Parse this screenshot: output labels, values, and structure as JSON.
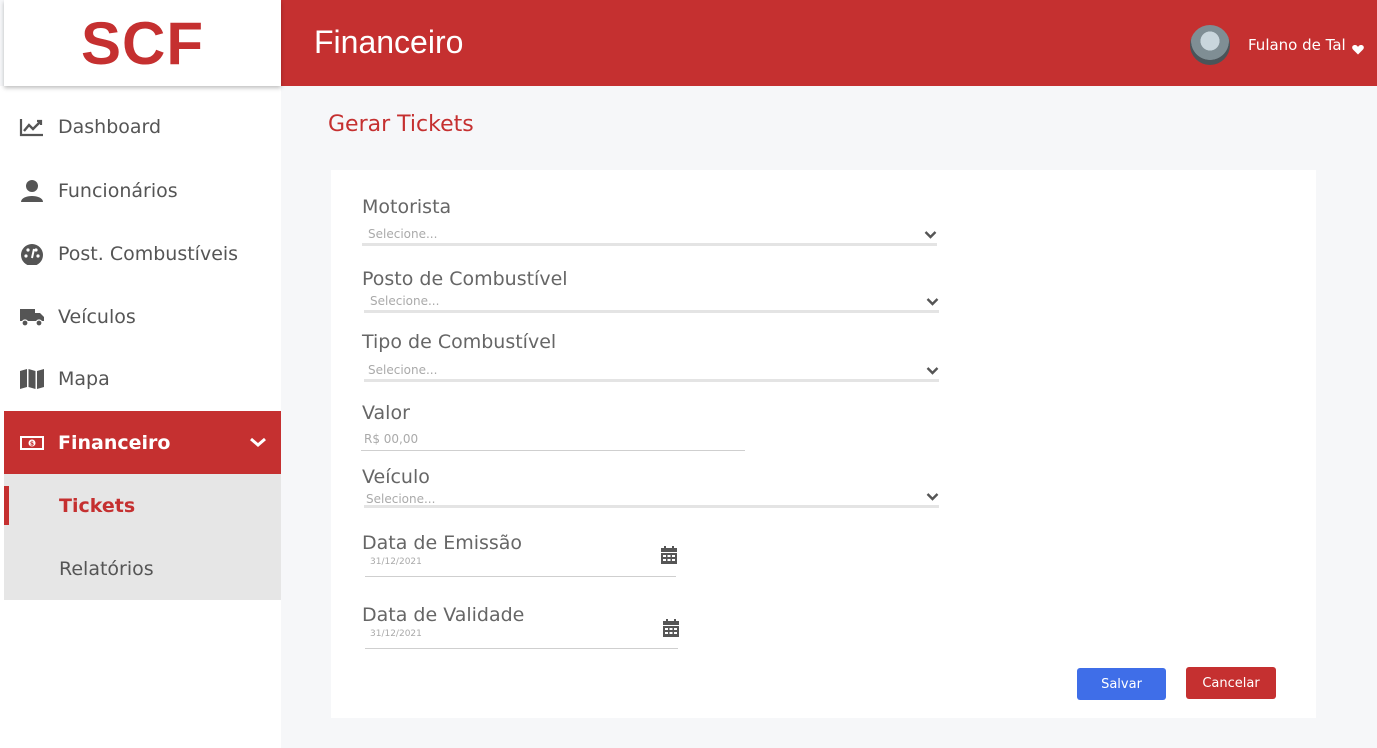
{
  "app": {
    "logo": "SCF"
  },
  "header": {
    "title": "Financeiro",
    "user_name": "Fulano de Tal"
  },
  "sidebar": {
    "items": [
      {
        "label": "Dashboard",
        "icon": "chart-line-icon"
      },
      {
        "label": "Funcionários",
        "icon": "user-icon"
      },
      {
        "label": "Post. Combustíveis",
        "icon": "gauge-icon"
      },
      {
        "label": "Veículos",
        "icon": "truck-icon"
      },
      {
        "label": "Mapa",
        "icon": "map-icon"
      },
      {
        "label": "Financeiro",
        "icon": "money-bill-icon",
        "active": true,
        "expanded": true
      }
    ],
    "submenu": [
      {
        "label": "Tickets",
        "active": true
      },
      {
        "label": "Relatórios",
        "active": false
      }
    ]
  },
  "main": {
    "page_title": "Gerar Tickets",
    "form": {
      "motorista": {
        "label": "Motorista",
        "placeholder": "Selecione..."
      },
      "posto": {
        "label": "Posto de Combustível",
        "placeholder": "Selecione..."
      },
      "tipo": {
        "label": "Tipo de Combustível",
        "placeholder": "Selecione..."
      },
      "valor": {
        "label": "Valor",
        "placeholder": "R$ 00,00"
      },
      "veiculo": {
        "label": "Veículo",
        "placeholder": "Selecione..."
      },
      "emissao": {
        "label": "Data  de Emissão",
        "value": "31/12/2021"
      },
      "validade": {
        "label": "Data  de Validade",
        "value": "31/12/2021"
      }
    },
    "buttons": {
      "save": "Salvar",
      "cancel": "Cancelar"
    }
  },
  "colors": {
    "primary": "#c53030",
    "save": "#3f6ee8",
    "submenu_bg": "#e6e6e6"
  }
}
